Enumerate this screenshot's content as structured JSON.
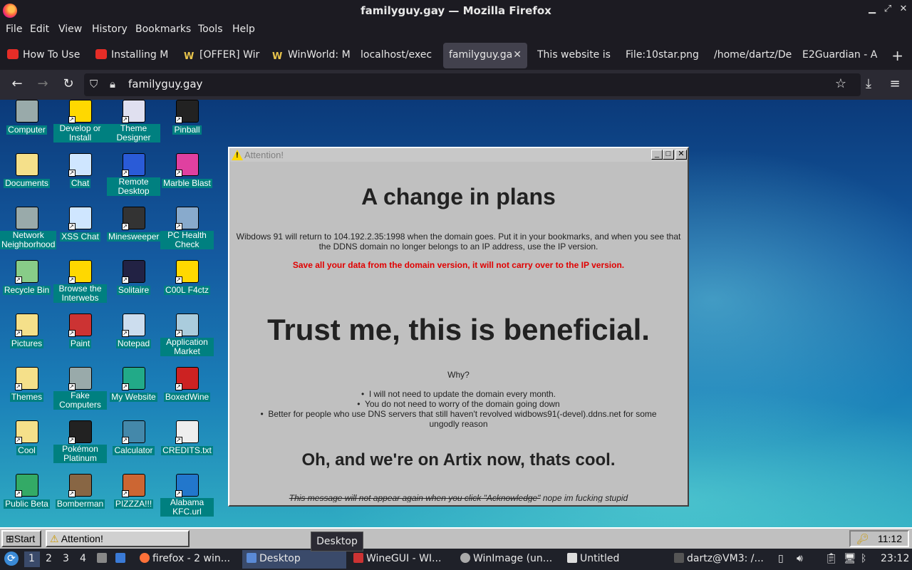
{
  "window": {
    "title": "familyguy.gay — Mozilla Firefox"
  },
  "menu": [
    "File",
    "Edit",
    "View",
    "History",
    "Bookmarks",
    "Tools",
    "Help"
  ],
  "tabs": [
    {
      "label": "How To Use",
      "icon": "youtube-icon"
    },
    {
      "label": "Installing M",
      "icon": "youtube-icon"
    },
    {
      "label": "[OFFER] Wir",
      "icon": "winworld-icon"
    },
    {
      "label": "WinWorld: M",
      "icon": "winworld-icon"
    },
    {
      "label": "localhost/exec",
      "icon": ""
    },
    {
      "label": "familyguy.ga",
      "icon": "",
      "active": true
    },
    {
      "label": "This website is",
      "icon": ""
    },
    {
      "label": "File:10star.png",
      "icon": ""
    },
    {
      "label": "/home/dartz/De",
      "icon": ""
    },
    {
      "label": "E2Guardian - A",
      "icon": ""
    }
  ],
  "address": {
    "url": "familyguy.gay"
  },
  "desktop_icons": [
    {
      "label": "Computer",
      "color": "#9aa"
    },
    {
      "label": "Develop or Install",
      "color": "#ffd800"
    },
    {
      "label": "Theme Designer",
      "color": "#e0e0f0"
    },
    {
      "label": "Pinball",
      "color": "#222"
    },
    {
      "label": "Documents",
      "color": "#f5e08a"
    },
    {
      "label": "Chat",
      "color": "#cfe6ff"
    },
    {
      "label": "Remote Desktop",
      "color": "#2a5bd7"
    },
    {
      "label": "Marble Blast",
      "color": "#e040a0"
    },
    {
      "label": "Network Neighborhood",
      "color": "#9aa"
    },
    {
      "label": "XSS Chat",
      "color": "#cfe6ff"
    },
    {
      "label": "Minesweeper",
      "color": "#333"
    },
    {
      "label": "PC Health Check",
      "color": "#8ac"
    },
    {
      "label": "Recycle Bin",
      "color": "#8c8"
    },
    {
      "label": "Browse the Interwebs",
      "color": "#ffd800"
    },
    {
      "label": "Solitaire",
      "color": "#224"
    },
    {
      "label": "C00L F4ctz",
      "color": "#ffd800"
    },
    {
      "label": "Pictures",
      "color": "#f5e08a"
    },
    {
      "label": "Paint",
      "color": "#c33"
    },
    {
      "label": "Notepad",
      "color": "#cde"
    },
    {
      "label": "Application Market",
      "color": "#acd"
    },
    {
      "label": "Themes",
      "color": "#f5e08a"
    },
    {
      "label": "Fake Computers",
      "color": "#9aa"
    },
    {
      "label": "My Website",
      "color": "#2a8"
    },
    {
      "label": "BoxedWine",
      "color": "#c22"
    },
    {
      "label": "Cool",
      "color": "#f5e08a"
    },
    {
      "label": "Pokémon Platinum",
      "color": "#222"
    },
    {
      "label": "Calculator",
      "color": "#48a"
    },
    {
      "label": "CREDITS.txt",
      "color": "#eee"
    },
    {
      "label": "Public Beta",
      "color": "#3a6"
    },
    {
      "label": "Bomberman",
      "color": "#864"
    },
    {
      "label": "PIZZZA!!!",
      "color": "#c63"
    },
    {
      "label": "Alabama KFC.url",
      "color": "#27c"
    }
  ],
  "dialog": {
    "title": "Attention!",
    "heading1": "A change in plans",
    "para1": "Wibdows 91 will return to 104.192.2.35:1998 when the domain goes. Put it in your bookmarks, and when you see that the DDNS domain no longer belongs to an IP address, use the IP version.",
    "warning": "Save all your data from the domain version, it will not carry over to the IP version.",
    "heading2": "Trust me, this is beneficial.",
    "why": "Why?",
    "bullets": [
      "I will not need to update the domain every month.",
      "You do not need to worry of the domain going down",
      "Better for people who use DNS servers that still haven't revolved widbows91(-devel).ddns.net for some ungodly reason"
    ],
    "heading3": "Oh, and we're on Artix now, thats cool.",
    "footer_struck": "This message will not appear again when you click \"Acknowledge\"",
    "footer_note": " nope im fucking stupid"
  },
  "w91_taskbar": {
    "start": "Start",
    "task": "Attention!",
    "clock": "11:12"
  },
  "tooltip": "Desktop",
  "panel": {
    "workspaces": [
      "1",
      "2",
      "3",
      "4"
    ],
    "tasks": [
      {
        "label": "firefox - 2 win...",
        "active": false
      },
      {
        "label": "Desktop",
        "active": true
      },
      {
        "label": "WineGUI - WI...",
        "active": false
      },
      {
        "label": "WinImage (un...",
        "active": false
      },
      {
        "label": "Untitled",
        "active": false
      },
      {
        "label": "dartz@VM3: /...",
        "active": false
      }
    ],
    "clock": "23:12"
  }
}
